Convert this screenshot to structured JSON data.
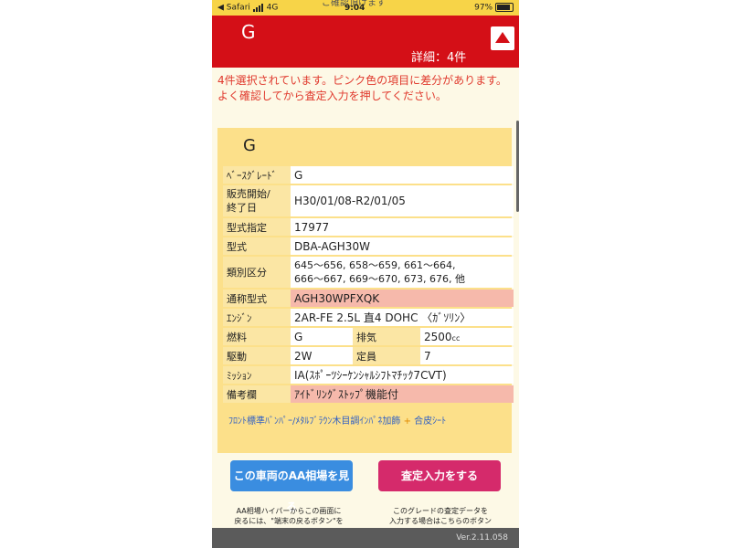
{
  "status_bar": {
    "carrier": "◀ Safari",
    "network": "4G",
    "time": "9:04",
    "battery": "97%",
    "ghost_title": "ご確認頂けます"
  },
  "header": {
    "grade_title": "G",
    "detail_count": "詳細：4件",
    "background": "#d40f17"
  },
  "notice": "4件選択されています。ピンク色の項目に差分があります。よく確認してから査定入力を押してください。",
  "card": {
    "title": "G",
    "rows": [
      {
        "label": "ﾍﾞｰｽｸﾞﾚｰﾄﾞ",
        "value": "G"
      },
      {
        "label": "販売開始/\n終了日",
        "value": "H30/01/08-R2/01/05"
      },
      {
        "label": "型式指定",
        "value": "17977"
      },
      {
        "label": "型式",
        "value": "DBA-AGH30W"
      },
      {
        "label": "類別区分",
        "value": "645～656, 658～659, 661～664,\n666～667, 669～670, 673, 676, 他"
      },
      {
        "label": "通称型式",
        "value": "AGH30WPFXQK"
      },
      {
        "label": "ｴﾝｼﾞﾝ",
        "value": "2AR-FE 2.5L 直4 DOHC 〈ｶﾞｿﾘﾝ〉"
      },
      {
        "label": "燃料",
        "value": "G",
        "label2": "排気",
        "value2": "2500",
        "value2_unit": "cc"
      },
      {
        "label": "駆動",
        "value": "2W",
        "label2": "定員",
        "value2": "7"
      },
      {
        "label": "ﾐｯｼｮﾝ",
        "value": "IA(ｽﾎﾟｰﾂｼｰｹﾝｼｬﾙｼﾌﾄﾏﾁｯｸ7CVT)"
      },
      {
        "label": "備考欄",
        "value": "ｱｲﾄﾞﾘﾝｸﾞｽﾄｯﾌﾟ機能付"
      }
    ],
    "options_link": "ﾌﾛﾝﾄ標準ﾊﾞﾝﾊﾟｰ/ﾒﾀﾙﾌﾞﾗｳﾝ木目調ｲﾝﾊﾟﾈ加飾",
    "options_plus": "+",
    "options_link2": "合皮ｼｰﾄ"
  },
  "buttons": {
    "aa_market": "この車両のAA相場を見る",
    "assess_input": "査定入力をする"
  },
  "footer": {
    "left_line1": "AA相場ハイパーからこの画面に",
    "left_line2": "戻るには、\"端末の戻るボタン\"を",
    "right_line1": "このグレードの査定データを",
    "right_line2": "入力する場合はこちらのボタン",
    "version": "Ver.2.11.058"
  }
}
